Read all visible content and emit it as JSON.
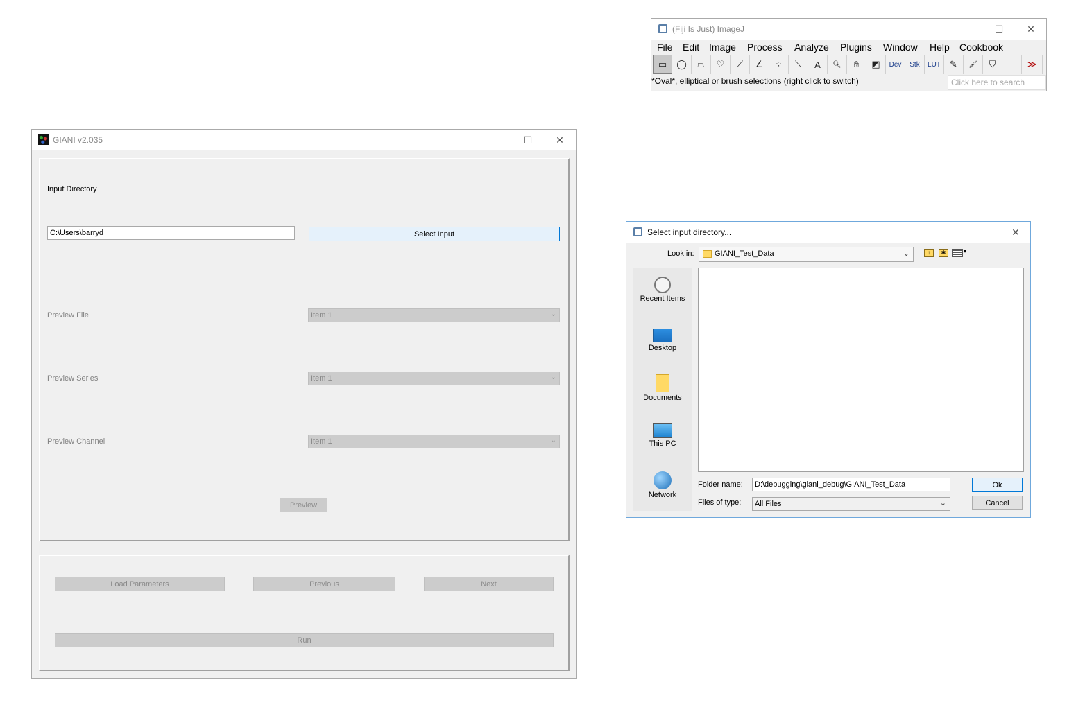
{
  "imagej": {
    "title": "(Fiji Is Just) ImageJ",
    "menus": [
      "File",
      "Edit",
      "Image",
      "Process",
      "Analyze",
      "Plugins",
      "Window",
      "Help",
      "Cookbook"
    ],
    "tools": [
      {
        "name": "rectangle-tool-icon",
        "glyph": "▭"
      },
      {
        "name": "oval-tool-icon",
        "glyph": "◯"
      },
      {
        "name": "polygon-tool-icon",
        "glyph": "⏢"
      },
      {
        "name": "freehand-tool-icon",
        "glyph": "♡"
      },
      {
        "name": "line-tool-icon",
        "glyph": "⟋"
      },
      {
        "name": "angle-tool-icon",
        "glyph": "∠"
      },
      {
        "name": "multipoint-tool-icon",
        "glyph": "⁘"
      },
      {
        "name": "wand-tool-icon",
        "glyph": "⟍"
      },
      {
        "name": "text-tool-icon",
        "glyph": "A"
      },
      {
        "name": "magnifier-tool-icon",
        "glyph": "🔍︎"
      },
      {
        "name": "hand-tool-icon",
        "glyph": "✋︎"
      },
      {
        "name": "color-picker-tool-icon",
        "glyph": "◩"
      },
      {
        "name": "dev-tool-icon",
        "glyph": "Dev"
      },
      {
        "name": "stk-tool-icon",
        "glyph": "Stk"
      },
      {
        "name": "lut-tool-icon",
        "glyph": "LUT"
      },
      {
        "name": "pencil-tool-icon",
        "glyph": "✎"
      },
      {
        "name": "brush-tool-icon",
        "glyph": "🖌︎"
      },
      {
        "name": "flood-fill-tool-icon",
        "glyph": "⛉"
      },
      {
        "name": "empty-tool-slot",
        "glyph": ""
      },
      {
        "name": "more-tools-icon",
        "glyph": "≫"
      }
    ],
    "status": "*Oval*, elliptical or brush selections (right click to switch)",
    "search_placeholder": "Click here to search"
  },
  "giani": {
    "title": "GIANI v2.035",
    "input_directory_label": "Input Directory",
    "input_path_value": "C:\\Users\\barryd",
    "select_input_label": "Select Input",
    "preview_file_label": "Preview File",
    "preview_file_value": "Item 1",
    "preview_series_label": "Preview Series",
    "preview_series_value": "Item 1",
    "preview_channel_label": "Preview Channel",
    "preview_channel_value": "Item 1",
    "preview_button": "Preview",
    "load_parameters_button": "Load Parameters",
    "previous_button": "Previous",
    "next_button": "Next",
    "run_button": "Run"
  },
  "dialog": {
    "title": "Select input directory...",
    "look_in_label": "Look in:",
    "look_in_value": "GIANI_Test_Data",
    "shortcuts": [
      "Recent Items",
      "Desktop",
      "Documents",
      "This PC",
      "Network"
    ],
    "folder_name_label": "Folder name:",
    "folder_name_value": "D:\\debugging\\giani_debug\\GIANI_Test_Data",
    "files_of_type_label": "Files of type:",
    "files_of_type_value": "All Files",
    "ok_button": "Ok",
    "cancel_button": "Cancel"
  },
  "colors": {
    "focus_blue": "#0078d7",
    "disabled_gray": "#cccccc",
    "window_bg": "#f0f0f0"
  }
}
